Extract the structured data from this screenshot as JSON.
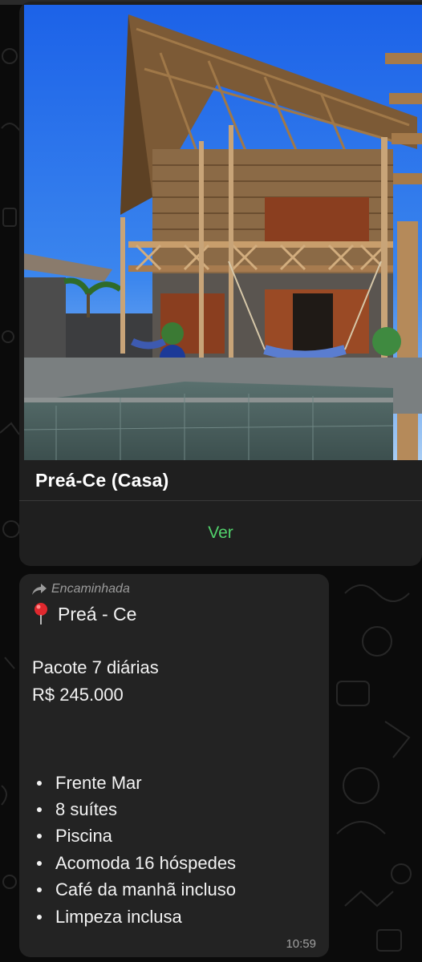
{
  "card": {
    "title": "Preá-Ce (Casa)",
    "link_label": "Ver",
    "link_color": "#51d16b"
  },
  "message": {
    "forwarded_label": "Encaminhada",
    "forwarded_icon": "forward-arrow-icon",
    "location_icon": "round-pushpin-icon",
    "location": "Preá - Ce",
    "package": "Pacote 7 diárias",
    "price": "R$ 245.000",
    "features": [
      "Frente Mar",
      "8 suítes",
      "Piscina",
      "Acomoda 16 hóspedes",
      "Café da manhã incluso",
      "Limpeza inclusa"
    ],
    "time": "10:59"
  }
}
